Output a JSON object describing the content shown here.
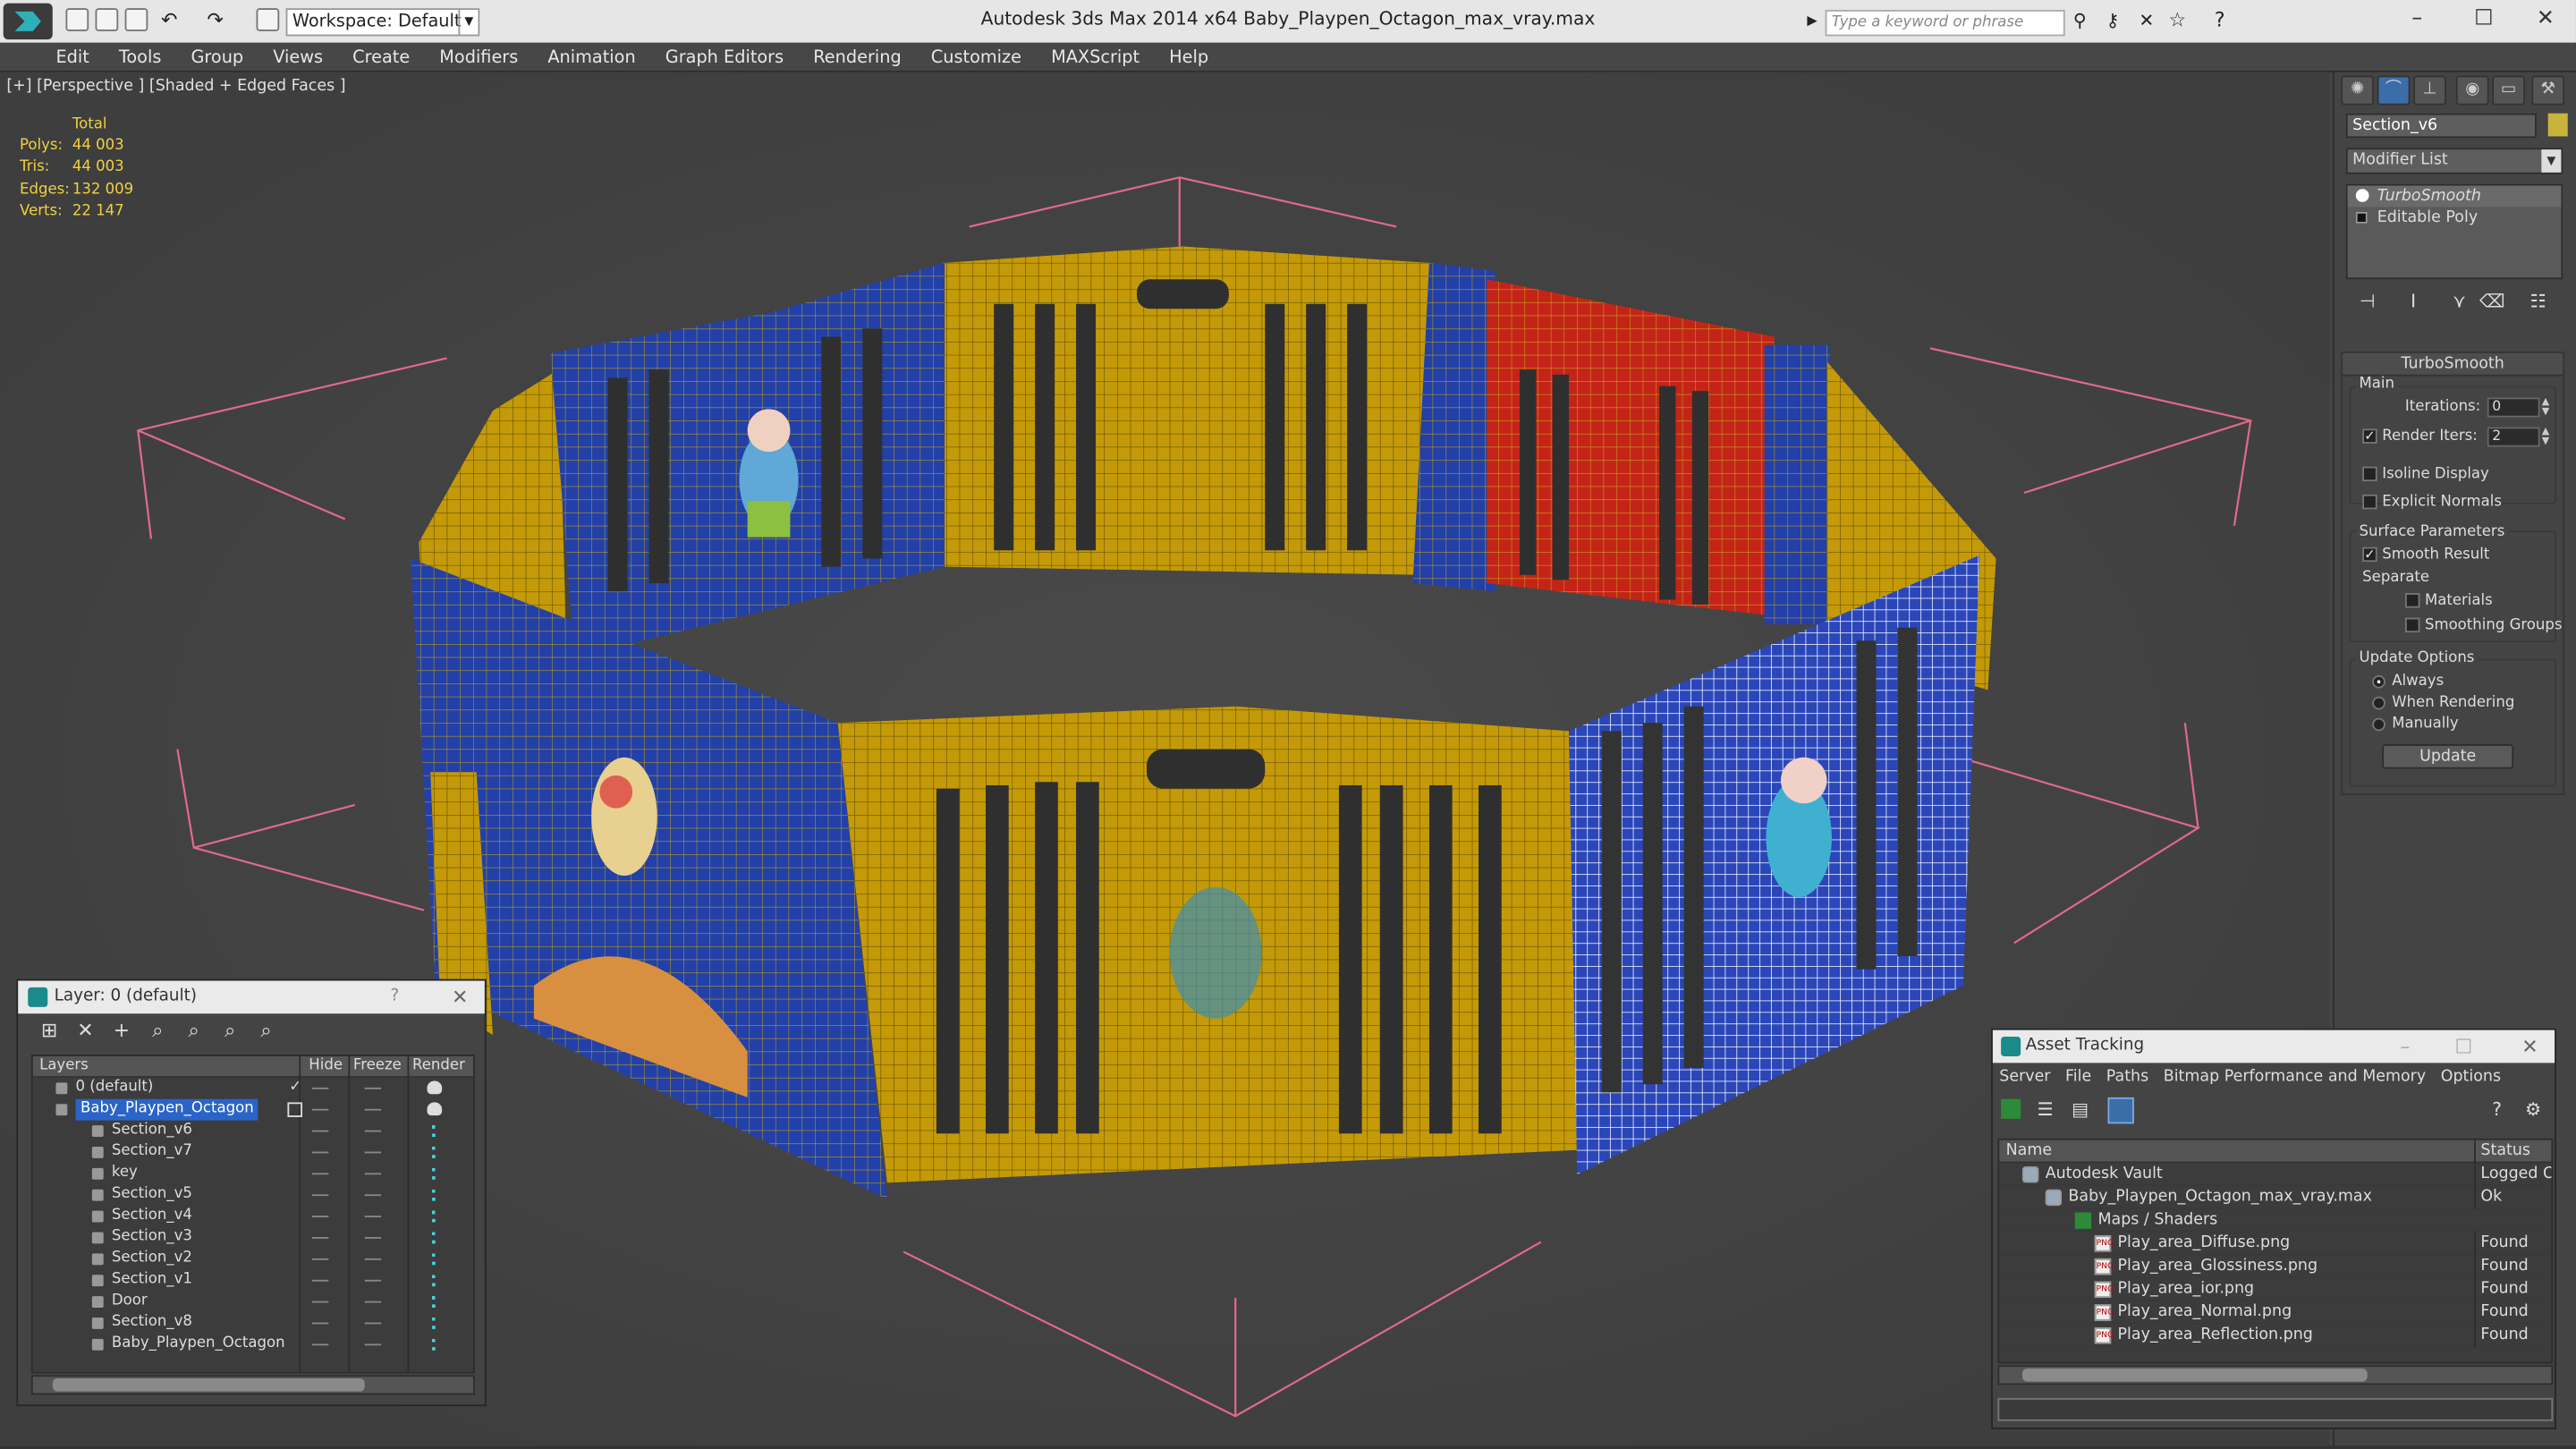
{
  "app": {
    "title": "Autodesk 3ds Max  2014 x64      Baby_Playpen_Octagon_max_vray.max",
    "workspace": "Workspace: Default",
    "search_placeholder": "Type a keyword or phrase"
  },
  "menu": [
    "Edit",
    "Tools",
    "Group",
    "Views",
    "Create",
    "Modifiers",
    "Animation",
    "Graph Editors",
    "Rendering",
    "Customize",
    "MAXScript",
    "Help"
  ],
  "viewport": {
    "label": "[+] [Perspective ] [Shaded + Edged Faces ]",
    "stats": {
      "total_label": "Total",
      "rows": [
        {
          "k": "Polys:",
          "v": "44 003"
        },
        {
          "k": "Tris:",
          "v": "44 003"
        },
        {
          "k": "Edges:",
          "v": "132 009"
        },
        {
          "k": "Verts:",
          "v": "22 147"
        }
      ]
    }
  },
  "command_panel": {
    "object_name": "Section_v6",
    "modifier_list": "Modifier List",
    "stack": [
      "TurboSmooth",
      "Editable Poly"
    ],
    "rollout_title": "TurboSmooth",
    "main_label": "Main",
    "iterations_label": "Iterations:",
    "iterations_value": "0",
    "render_iters_label": "Render Iters:",
    "render_iters_value": "2",
    "isoline_label": "Isoline Display",
    "explicit_label": "Explicit Normals",
    "surface_label": "Surface Parameters",
    "smooth_label": "Smooth Result",
    "separate_label": "Separate",
    "materials_label": "Materials",
    "smoothing_groups_label": "Smoothing Groups",
    "update_options_label": "Update Options",
    "always_label": "Always",
    "when_rendering_label": "When Rendering",
    "manually_label": "Manually",
    "update_button": "Update"
  },
  "layer_window": {
    "title": "Layer: 0 (default)",
    "help": "?",
    "columns": {
      "layers": "Layers",
      "hide": "Hide",
      "freeze": "Freeze",
      "render": "Render"
    },
    "rows": [
      {
        "name": "0 (default)",
        "indent": 0
      },
      {
        "name": "Baby_Playpen_Octagon",
        "indent": 0
      },
      {
        "name": "Section_v6",
        "indent": 1
      },
      {
        "name": "Section_v7",
        "indent": 1
      },
      {
        "name": "key",
        "indent": 1
      },
      {
        "name": "Section_v5",
        "indent": 1
      },
      {
        "name": "Section_v4",
        "indent": 1
      },
      {
        "name": "Section_v3",
        "indent": 1
      },
      {
        "name": "Section_v2",
        "indent": 1
      },
      {
        "name": "Section_v1",
        "indent": 1
      },
      {
        "name": "Door",
        "indent": 1
      },
      {
        "name": "Section_v8",
        "indent": 1
      },
      {
        "name": "Baby_Playpen_Octagon",
        "indent": 1
      }
    ]
  },
  "asset_window": {
    "title": "Asset Tracking",
    "menu": [
      "Server",
      "File",
      "Paths",
      "Bitmap Performance and Memory",
      "Options"
    ],
    "columns": {
      "name": "Name",
      "status": "Status"
    },
    "rows": [
      {
        "name": "Autodesk Vault",
        "status": "Logged Out",
        "level": 0
      },
      {
        "name": "Baby_Playpen_Octagon_max_vray.max",
        "status": "Ok",
        "level": 1
      },
      {
        "name": "Maps / Shaders",
        "status": "",
        "level": 2
      },
      {
        "name": "Play_area_Diffuse.png",
        "status": "Found",
        "level": 3
      },
      {
        "name": "Play_area_Glossiness.png",
        "status": "Found",
        "level": 3
      },
      {
        "name": "Play_area_ior.png",
        "status": "Found",
        "level": 3
      },
      {
        "name": "Play_area_Normal.png",
        "status": "Found",
        "level": 3
      },
      {
        "name": "Play_area_Reflection.png",
        "status": "Found",
        "level": 3
      }
    ]
  },
  "colors": {
    "yellow": "#c8a010",
    "blue": "#2a44a8",
    "red": "#c02818",
    "selected_blue": "#2a64c8"
  }
}
